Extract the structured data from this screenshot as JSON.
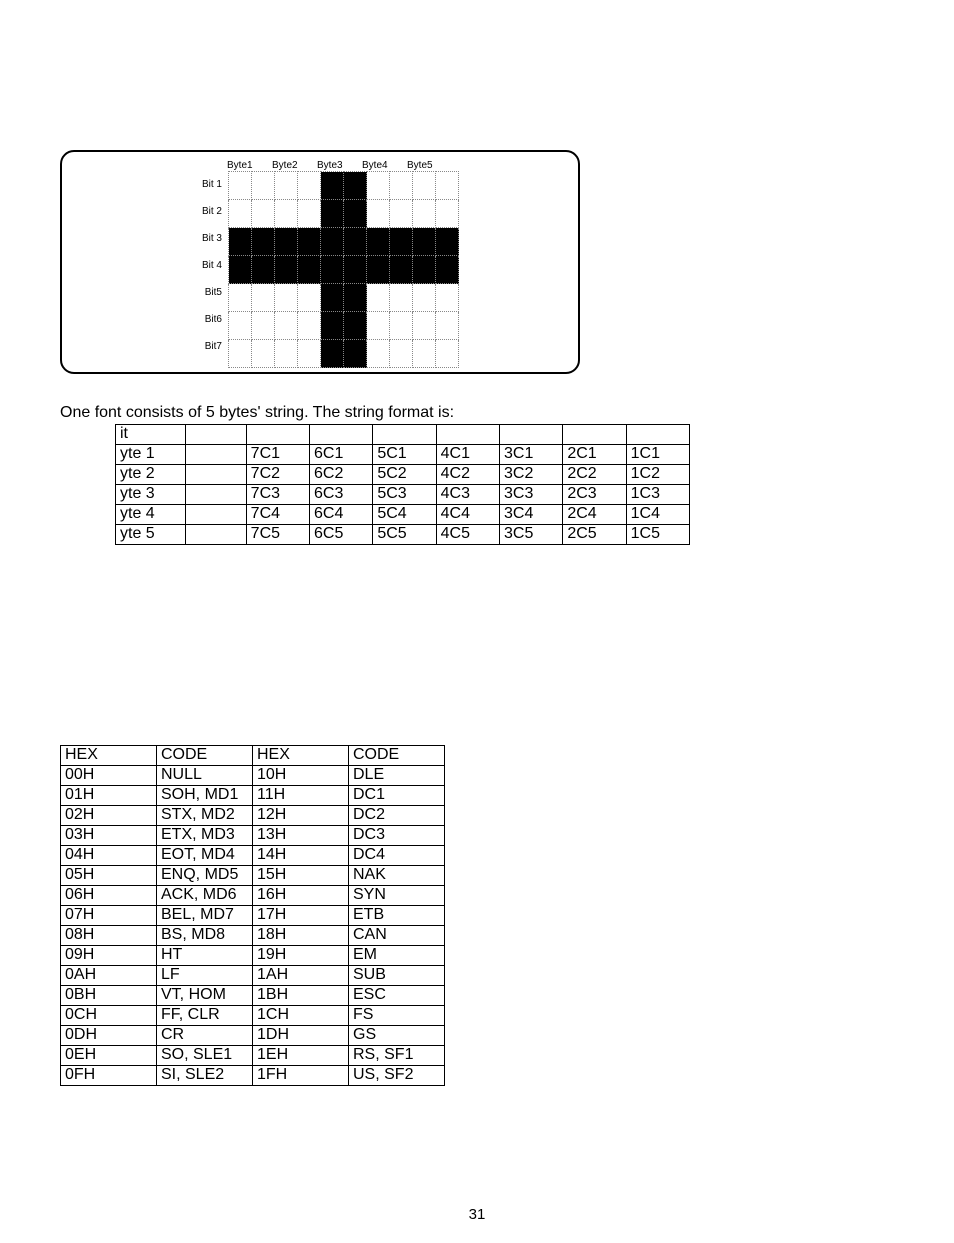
{
  "figure": {
    "byteHeaders": [
      "Byte1",
      "Byte2",
      "Byte3",
      "Byte4",
      "Byte5"
    ],
    "bitLabels": [
      "Bit 1",
      "Bit 2",
      "Bit 3",
      "Bit 4",
      "Bit5",
      "Bit6",
      "Bit7"
    ]
  },
  "caption": "One font consists of 5 bytes' string. The string format is:",
  "byteString": {
    "headerRow": [
      "it",
      "",
      "",
      "",
      "",
      "",
      "",
      "",
      ""
    ],
    "rows": [
      [
        "yte 1",
        "",
        "7C1",
        "6C1",
        "5C1",
        "4C1",
        "3C1",
        "2C1",
        "1C1"
      ],
      [
        "yte 2",
        "",
        "7C2",
        "6C2",
        "5C2",
        "4C2",
        "3C2",
        "2C2",
        "1C2"
      ],
      [
        "yte 3",
        "",
        "7C3",
        "6C3",
        "5C3",
        "4C3",
        "3C3",
        "2C3",
        "1C3"
      ],
      [
        "yte 4",
        "",
        "7C4",
        "6C4",
        "5C4",
        "4C4",
        "3C4",
        "2C4",
        "1C4"
      ],
      [
        "yte 5",
        "",
        "7C5",
        "6C5",
        "5C5",
        "4C5",
        "3C5",
        "2C5",
        "1C5"
      ]
    ]
  },
  "hexTable": {
    "header": [
      "HEX",
      "CODE",
      "HEX",
      "CODE"
    ],
    "rows": [
      [
        "00H",
        "NULL",
        "10H",
        "DLE"
      ],
      [
        "01H",
        "SOH, MD1",
        "11H",
        "DC1"
      ],
      [
        "02H",
        "STX, MD2",
        "12H",
        "DC2"
      ],
      [
        "03H",
        "ETX, MD3",
        "13H",
        "DC3"
      ],
      [
        "04H",
        "EOT, MD4",
        "14H",
        "DC4"
      ],
      [
        "05H",
        "ENQ, MD5",
        "15H",
        "NAK"
      ],
      [
        "06H",
        "ACK, MD6",
        "16H",
        "SYN"
      ],
      [
        "07H",
        "BEL, MD7",
        "17H",
        "ETB"
      ],
      [
        "08H",
        "BS, MD8",
        "18H",
        "CAN"
      ],
      [
        "09H",
        "HT",
        "19H",
        "EM"
      ],
      [
        "0AH",
        "LF",
        "1AH",
        "SUB"
      ],
      [
        "0BH",
        "VT, HOM",
        "1BH",
        "ESC"
      ],
      [
        "0CH",
        "FF, CLR",
        "1CH",
        "FS"
      ],
      [
        "0DH",
        "CR",
        "1DH",
        "GS"
      ],
      [
        "0EH",
        "SO, SLE1",
        "1EH",
        "RS, SF1"
      ],
      [
        "0FH",
        "SI, SLE2",
        "1FH",
        "US, SF2"
      ]
    ]
  },
  "chart_data": {
    "type": "table",
    "title": "5x7 font bitmap example (plus-sign glyph)",
    "columns": [
      "Byte1",
      "Byte2",
      "Byte3",
      "Byte4",
      "Byte5"
    ],
    "rows": [
      "Bit 1",
      "Bit 2",
      "Bit 3",
      "Bit 4",
      "Bit5",
      "Bit6",
      "Bit7"
    ],
    "grid": [
      [
        0,
        0,
        1,
        0,
        0
      ],
      [
        0,
        0,
        1,
        0,
        0
      ],
      [
        1,
        1,
        1,
        1,
        1
      ],
      [
        1,
        1,
        1,
        1,
        1
      ],
      [
        0,
        0,
        1,
        0,
        0
      ],
      [
        0,
        0,
        1,
        0,
        0
      ],
      [
        0,
        0,
        1,
        0,
        0
      ]
    ]
  },
  "pageNumber": "31"
}
